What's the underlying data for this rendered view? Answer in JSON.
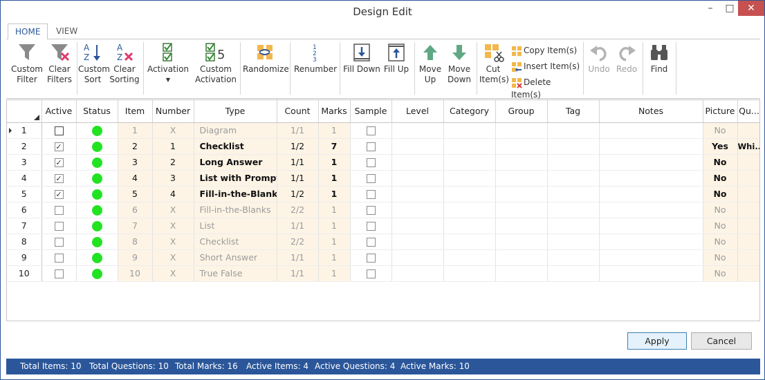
{
  "window": {
    "title": "Design Edit",
    "minimize": "–",
    "maximize": "□",
    "close": "✕"
  },
  "tabs": [
    {
      "label": "HOME"
    },
    {
      "label": "VIEW"
    }
  ],
  "ribbon": {
    "custom_filter": "Custom Filter",
    "clear_filters": "Clear Filters",
    "custom_sort": "Custom Sort",
    "clear_sorting": "Clear Sorting",
    "activation": "Activation",
    "custom_activation": "Custom Activation",
    "randomize": "Randomize",
    "renumber": "Renumber",
    "fill_down": "Fill Down",
    "fill_up": "Fill Up",
    "move_up": "Move Up",
    "move_down": "Move Down",
    "cut_items": "Cut Item(s)",
    "copy_items": "Copy Item(s)",
    "insert_items": "Insert Item(s)",
    "delete_items": "Delete Item(s)",
    "undo": "Undo",
    "redo": "Redo",
    "find": "Find",
    "custom_activation_number": "5",
    "renumber_digits": [
      "1",
      "2",
      "3"
    ],
    "sort_letters": "AZ",
    "clear_sort_letters": "AZ"
  },
  "colors": {
    "accent": "#2b579a",
    "status_green": "#22e322",
    "cream": "#fdf4e6",
    "close_red": "#c75050"
  },
  "grid": {
    "columns": [
      "Active",
      "Status",
      "Item",
      "Number",
      "Type",
      "Count",
      "Marks",
      "Sample",
      "Level",
      "Category",
      "Group",
      "Tag",
      "Notes",
      "Picture",
      "Qu..."
    ],
    "rows": [
      {
        "row": "1",
        "active": false,
        "item": "1",
        "number": "X",
        "type": "Diagram",
        "count": "1/1",
        "marks": "1",
        "picture": "No",
        "qu": ""
      },
      {
        "row": "2",
        "active": true,
        "item": "2",
        "number": "1",
        "type": "Checklist",
        "count": "1/2",
        "marks": "7",
        "picture": "Yes",
        "qu": "Whi..."
      },
      {
        "row": "3",
        "active": true,
        "item": "3",
        "number": "2",
        "type": "Long Answer",
        "count": "1/1",
        "marks": "1",
        "picture": "No",
        "qu": ""
      },
      {
        "row": "4",
        "active": true,
        "item": "4",
        "number": "3",
        "type": "List with Prompts",
        "count": "1/1",
        "marks": "1",
        "picture": "No",
        "qu": ""
      },
      {
        "row": "5",
        "active": true,
        "item": "5",
        "number": "4",
        "type": "Fill-in-the-Blanks",
        "count": "1/2",
        "marks": "1",
        "picture": "No",
        "qu": ""
      },
      {
        "row": "6",
        "active": false,
        "item": "6",
        "number": "X",
        "type": "Fill-in-the-Blanks",
        "count": "2/2",
        "marks": "1",
        "picture": "No",
        "qu": ""
      },
      {
        "row": "7",
        "active": false,
        "item": "7",
        "number": "X",
        "type": "List",
        "count": "1/1",
        "marks": "1",
        "picture": "No",
        "qu": ""
      },
      {
        "row": "8",
        "active": false,
        "item": "8",
        "number": "X",
        "type": "Checklist",
        "count": "2/2",
        "marks": "1",
        "picture": "No",
        "qu": ""
      },
      {
        "row": "9",
        "active": false,
        "item": "9",
        "number": "X",
        "type": "Short Answer",
        "count": "1/1",
        "marks": "1",
        "picture": "No",
        "qu": ""
      },
      {
        "row": "10",
        "active": false,
        "item": "10",
        "number": "X",
        "type": "True False",
        "count": "1/1",
        "marks": "1",
        "picture": "No",
        "qu": ""
      }
    ],
    "checkmark": "✓"
  },
  "buttons": {
    "apply": "Apply",
    "cancel": "Cancel"
  },
  "status": {
    "total_items": "Total Items: 10",
    "total_questions": "Total Questions: 10",
    "total_marks": "Total Marks: 16",
    "active_items": "Active Items: 4",
    "active_questions": "Active Questions: 4",
    "active_marks": "Active Marks: 10"
  }
}
